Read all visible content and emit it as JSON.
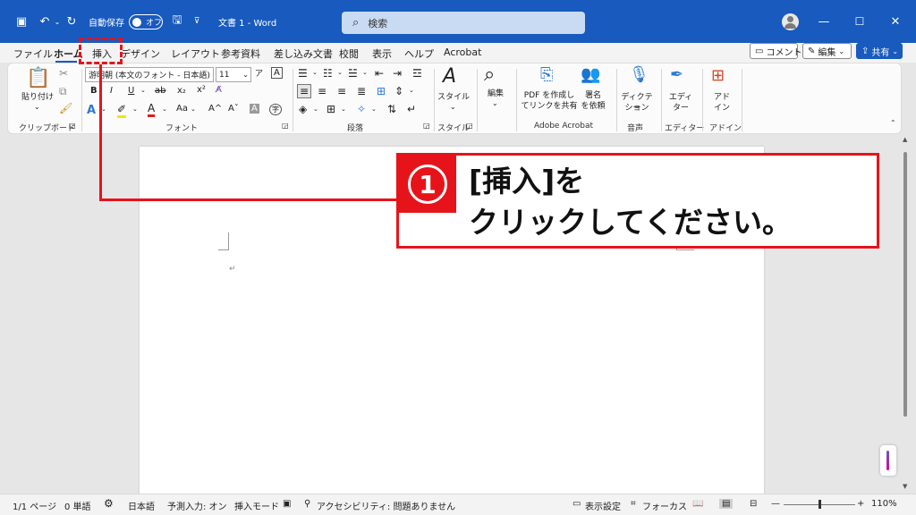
{
  "titlebar": {
    "autosave_label": "自動保存",
    "autosave_state": "オフ",
    "doc_title": "文書 1  -  Word",
    "search_placeholder": "検索"
  },
  "tabs": [
    {
      "label": "ファイル"
    },
    {
      "label": "ホーム",
      "active": true
    },
    {
      "label": "挿入"
    },
    {
      "label": "デザイン"
    },
    {
      "label": "レイアウト"
    },
    {
      "label": "参考資料"
    },
    {
      "label": "差し込み文書"
    },
    {
      "label": "校閲"
    },
    {
      "label": "表示"
    },
    {
      "label": "ヘルプ"
    },
    {
      "label": "Acrobat"
    }
  ],
  "ribbon_buttons": {
    "comment": "コメント",
    "edit": "編集",
    "share": "共有"
  },
  "clipboard": {
    "paste": "貼り付け",
    "group": "クリップボード"
  },
  "font": {
    "name": "游明朝 (本文のフォント - 日本語)",
    "size": "11",
    "bold": "B",
    "italic": "I",
    "underline": "U",
    "strike": "ab",
    "subscript": "x₂",
    "superscript": "x²",
    "case": "Aa",
    "grow": "A^",
    "shrink": "Aˇ",
    "group": "フォント"
  },
  "paragraph": {
    "group": "段落"
  },
  "styles": {
    "label": "スタイル",
    "group": "スタイル"
  },
  "editing": {
    "label": "編集"
  },
  "acrobat": {
    "pdf_line1": "PDF を作成し",
    "pdf_line2": "てリンクを共有",
    "sign_line1": "署名",
    "sign_line2": "を依頼",
    "group": "Adobe Acrobat"
  },
  "voice": {
    "label": "ディクテー",
    "label2": "ション",
    "group": "音声"
  },
  "editor": {
    "label": "エディ",
    "label2": "ター",
    "group": "エディター"
  },
  "addins": {
    "label": "アド",
    "label2": "イン",
    "group": "アドイン"
  },
  "statusbar": {
    "page": "1/1 ページ",
    "words": "0 単語",
    "language": "日本語",
    "predict": "予測入力: オン",
    "insert_mode": "挿入モード",
    "accessibility": "アクセシビリティ: 問題ありません",
    "display_settings": "表示設定",
    "focus": "フォーカス",
    "zoom": "110%"
  },
  "annotation": {
    "number": "1",
    "line1": "[挿入]を",
    "line2": "クリックしてください。"
  },
  "colors": {
    "word_blue": "#185abd",
    "annotation_red": "#e6141a"
  }
}
